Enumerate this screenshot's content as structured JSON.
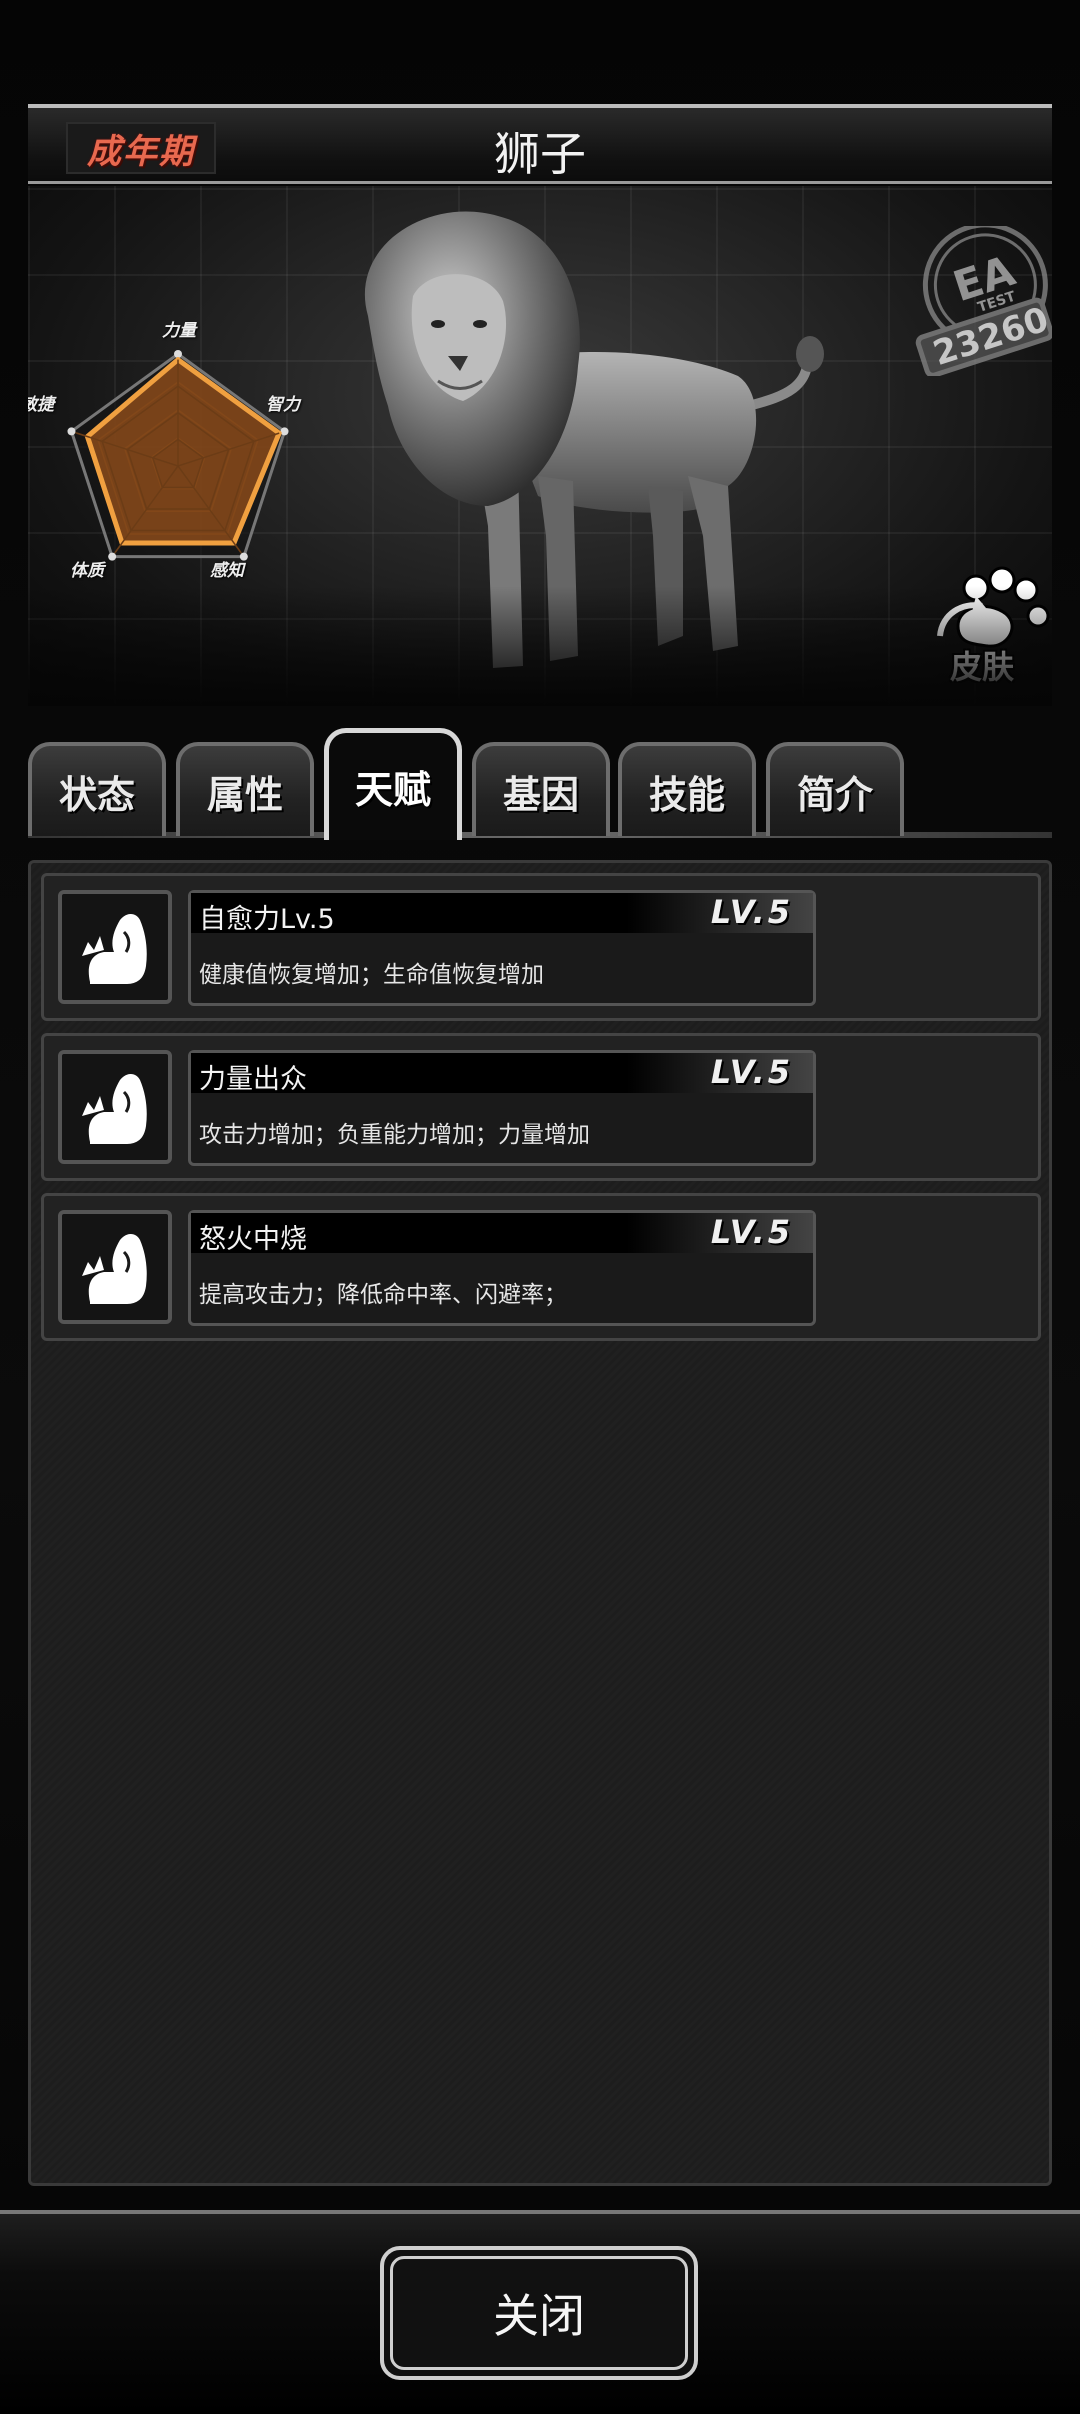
{
  "header": {
    "stage": "成年期",
    "title": "狮子"
  },
  "radar": {
    "labels": {
      "strength": "力量",
      "intelligence": "智力",
      "perception": "感知",
      "constitution": "体质",
      "agility": "敏捷"
    },
    "values": {
      "strength": 0.95,
      "intelligence": 0.95,
      "perception": 0.85,
      "constitution": 0.85,
      "agility": 0.85
    },
    "fill_color": "#8a4a1a",
    "stroke_color": "#f0a040"
  },
  "stamp": {
    "line1": "EA",
    "line2": "TEST",
    "number": "23260"
  },
  "skin_button": {
    "label": "皮肤",
    "icon": "paw-icon"
  },
  "tabs": [
    {
      "label": "状态",
      "active": false
    },
    {
      "label": "属性",
      "active": false
    },
    {
      "label": "天赋",
      "active": true
    },
    {
      "label": "基因",
      "active": false
    },
    {
      "label": "技能",
      "active": false
    },
    {
      "label": "简介",
      "active": false
    }
  ],
  "talents": [
    {
      "name": "自愈力Lv.5",
      "level": "LV.5",
      "desc": "健康值恢复增加；生命值恢复增加",
      "icon": "muscle-arm-icon"
    },
    {
      "name": "力量出众",
      "level": "LV.5",
      "desc": "攻击力增加；负重能力增加；力量增加",
      "icon": "muscle-arm-icon"
    },
    {
      "name": "怒火中烧",
      "level": "LV.5",
      "desc": "提高攻击力；降低命中率、闪避率；",
      "icon": "muscle-arm-icon"
    }
  ],
  "footer": {
    "close_label": "关闭"
  }
}
